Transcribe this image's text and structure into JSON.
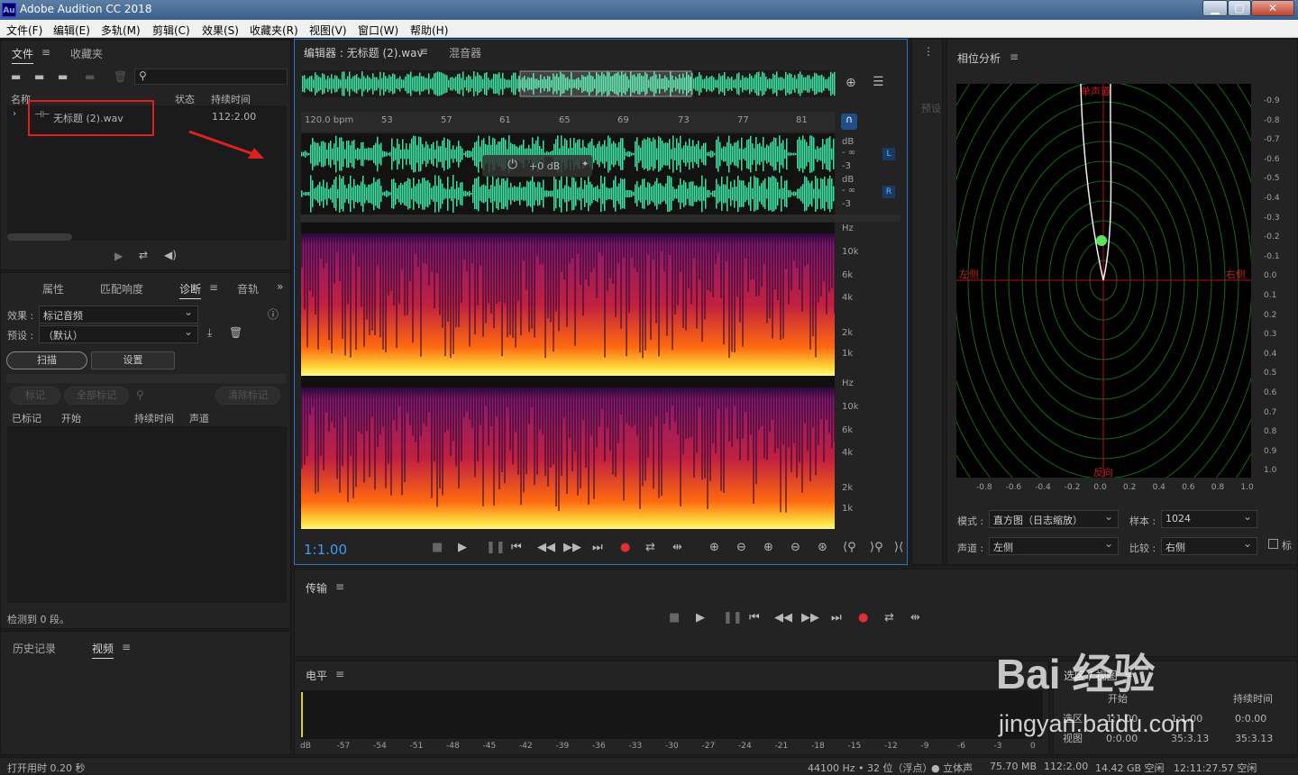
{
  "app": {
    "logo": "Au",
    "title": "Adobe Audition CC 2018",
    "min": "▁",
    "max": "▢",
    "close": "✕"
  },
  "menu": [
    "文件(F)",
    "编辑(E)",
    "多轨(M)",
    "剪辑(C)",
    "效果(S)",
    "收藏夹(R)",
    "视图(V)",
    "窗口(W)",
    "帮助(H)"
  ],
  "files": {
    "tabs": [
      "文件",
      "收藏夹"
    ],
    "cols": {
      "name": "名称",
      "status": "状态",
      "duration": "持续时间"
    },
    "item": {
      "name": "无标题 (2).wav",
      "duration": "112:2.00"
    }
  },
  "diag": {
    "tabs": [
      "属性",
      "匹配响度",
      "诊断",
      "音轨"
    ],
    "effect_label": "效果 :",
    "effect": "标记音频",
    "preset_label": "预设 :",
    "preset": "（默认）",
    "scan": "扫描",
    "settings": "设置",
    "mark": "标记",
    "mark_all": "全部标记",
    "clear": "清除标记",
    "cols": [
      "已标记",
      "开始",
      "持续时间",
      "声道"
    ],
    "footer": "检测到 0 段。"
  },
  "hist": {
    "tabs": [
      "历史记录",
      "视频"
    ]
  },
  "editor": {
    "tab": "编辑器 : 无标题 (2).wav",
    "mixer": "混音器",
    "bpm": "120.0 bpm",
    "ruler": [
      "53",
      "57",
      "61",
      "65",
      "69",
      "73",
      "77",
      "81"
    ],
    "db": [
      "dB",
      "- ∞",
      "-3",
      "dB",
      "- ∞",
      "-3"
    ],
    "ch_l": "L",
    "ch_r": "R",
    "hz1": [
      "Hz",
      "10k",
      "6k",
      "4k",
      "2k",
      "1k"
    ],
    "hz2": [
      "Hz",
      "10k",
      "6k",
      "4k",
      "2k",
      "1k"
    ],
    "gain": "+0 dB",
    "time": "1:1.00"
  },
  "preset_side": "预设",
  "phase": {
    "title": "相位分析",
    "single": "单声道",
    "left": "左侧",
    "right": "右侧",
    "reverse": "反向",
    "yticks": [
      "0.9",
      "0.8",
      "0.7",
      "0.6",
      "0.5",
      "0.4",
      "0.3",
      "0.2",
      "0.1",
      "0.0",
      "0.1",
      "0.2",
      "0.3",
      "0.4",
      "0.5",
      "0.6",
      "0.7",
      "0.8",
      "0.9",
      "1.0"
    ],
    "xticks": [
      "-0.8",
      "-0.6",
      "-0.4",
      "-0.2",
      "0.0",
      "0.2",
      "0.4",
      "0.6",
      "0.8",
      "1.0"
    ],
    "mode_label": "模式 :",
    "mode": "直方图（日志缩放）",
    "sample_label": "样本 :",
    "sample": "1024",
    "channel_label": "声道 :",
    "channel": "左侧",
    "compare_label": "比较 :",
    "compare": "右侧",
    "mark": "标"
  },
  "transport": {
    "title": "传输"
  },
  "levels": {
    "title": "电平",
    "ticks": [
      "dB",
      "-57",
      "-54",
      "-51",
      "-48",
      "-45",
      "-42",
      "-39",
      "-36",
      "-33",
      "-30",
      "-27",
      "-24",
      "-21",
      "-18",
      "-15",
      "-12",
      "-9",
      "-6",
      "-3",
      "0"
    ]
  },
  "selview": {
    "title": "选区 / 视图",
    "start": "开始",
    "duration": "持续时间",
    "row1": "选区",
    "v1": "1:1.00",
    "v2": "1:1.00",
    "v3": "0:0.00",
    "row2": "视图",
    "v4": "0:0.00",
    "v5": "35:3.13",
    "v6": "35:3.13"
  },
  "status": {
    "left": "打开用时 0.20 秒",
    "rate": "44100 Hz • 32 位（浮点）",
    "stereo": "● 立体声",
    "size": "75.70 MB",
    "dur": "112:2.00",
    "free": "14.42 GB 空闲",
    "time": "12:11:27.57 空闲"
  },
  "watermark": {
    "brand": "Bai 经验",
    "url": "jingyan.baidu.com"
  },
  "colors": {
    "wave": "#3de0a0",
    "accent": "#3d9cf5",
    "record": "#e03030",
    "highlight": "#e02020"
  }
}
